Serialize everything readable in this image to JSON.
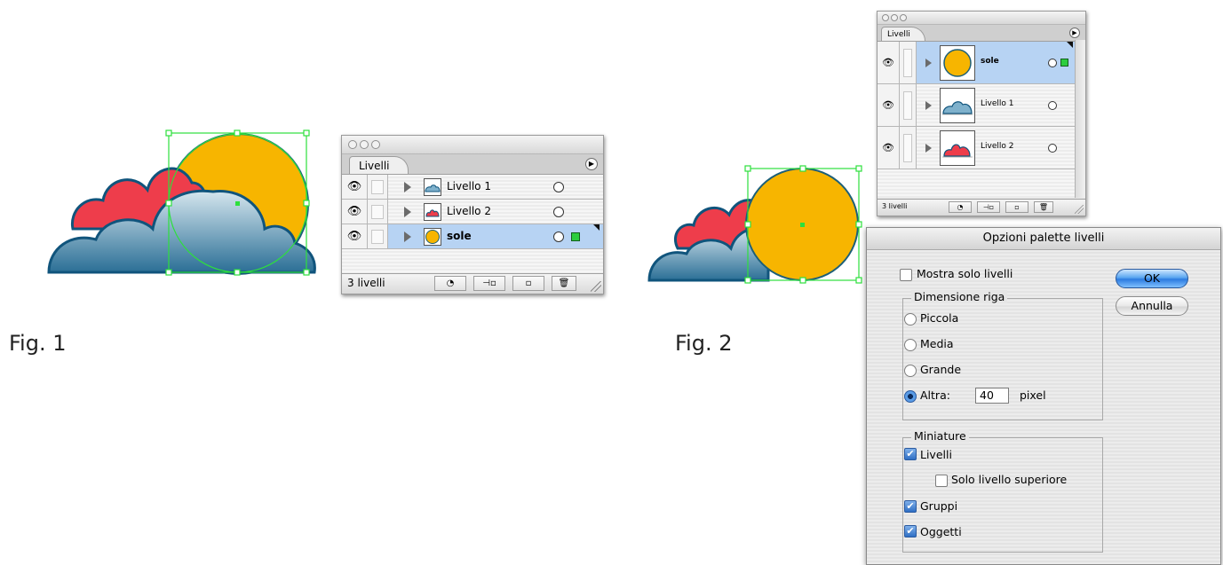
{
  "figures": {
    "fig1_label": "Fig. 1",
    "fig2_label": "Fig. 2"
  },
  "palette1": {
    "tab_label": "Livelli",
    "layers": [
      {
        "name": "Livello 1",
        "selected": false,
        "thumb": "blue-cloud"
      },
      {
        "name": "Livello 2",
        "selected": false,
        "thumb": "red-cloud"
      },
      {
        "name": "sole",
        "selected": true,
        "thumb": "sun"
      }
    ],
    "footer_count": "3 livelli"
  },
  "palette2": {
    "tab_label": "Livelli",
    "layers": [
      {
        "name": "sole",
        "selected": true,
        "thumb": "sun"
      },
      {
        "name": "Livello 1",
        "selected": false,
        "thumb": "blue-cloud"
      },
      {
        "name": "Livello 2",
        "selected": false,
        "thumb": "red-cloud"
      }
    ],
    "footer_count": "3 livelli"
  },
  "dialog": {
    "title": "Opzioni palette livelli",
    "show_only_layers": {
      "label": "Mostra solo livelli",
      "checked": false
    },
    "row_size": {
      "title": "Dimensione riga",
      "options": [
        {
          "label": "Piccola",
          "selected": false
        },
        {
          "label": "Media",
          "selected": false
        },
        {
          "label": "Grande",
          "selected": false
        },
        {
          "label": "Altra:",
          "selected": true
        }
      ],
      "other_value": "40",
      "unit": "pixel"
    },
    "thumbnails": {
      "title": "Miniature",
      "livelli": {
        "label": "Livelli",
        "checked": true
      },
      "solo_superiore": {
        "label": "Solo livello superiore",
        "checked": false
      },
      "gruppi": {
        "label": "Gruppi",
        "checked": true
      },
      "oggetti": {
        "label": "Oggetti",
        "checked": true
      }
    },
    "ok_label": "OK",
    "cancel_label": "Annulla"
  },
  "colors": {
    "sun": "#f7b500",
    "red_cloud": "#ee3d4b",
    "cloud_dark": "#10547c",
    "cloud_light": "#d5e6ee",
    "selection": "#2de03c",
    "row_highlight": "#b7d3f3"
  }
}
